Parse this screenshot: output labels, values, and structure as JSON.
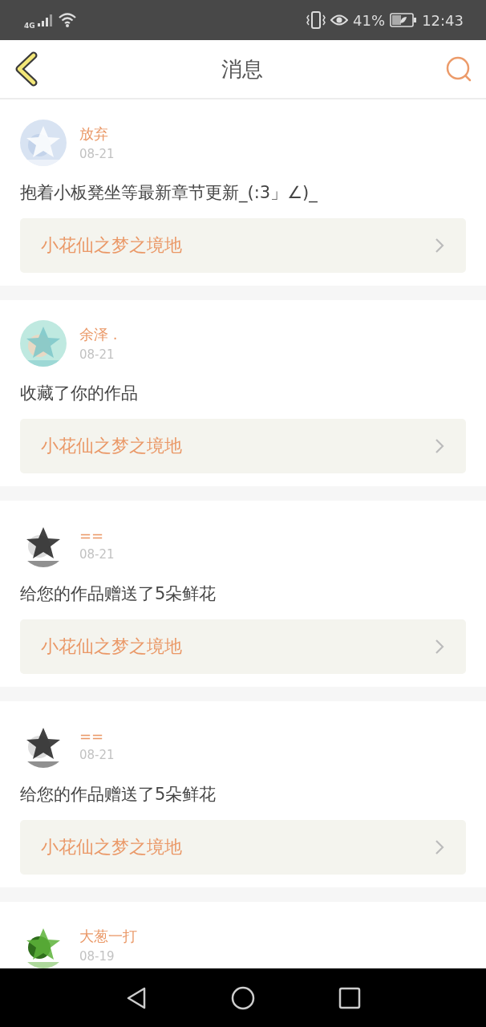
{
  "status_bar": {
    "network": "4G",
    "battery": "41%",
    "time": "12:43"
  },
  "header": {
    "title": "消息"
  },
  "messages": [
    {
      "name": "放弃",
      "date": "08-21",
      "text": "抱着小板凳坐等最新章节更新_(:3」∠)_",
      "link": "小花仙之梦之境地"
    },
    {
      "name": "余泽 .",
      "date": "08-21",
      "text": "收藏了你的作品",
      "link": "小花仙之梦之境地"
    },
    {
      "name": "==",
      "date": "08-21",
      "text": "给您的作品赠送了5朵鲜花",
      "link": "小花仙之梦之境地"
    },
    {
      "name": "==",
      "date": "08-21",
      "text": "给您的作品赠送了5朵鲜花",
      "link": "小花仙之梦之境地"
    },
    {
      "name": "大葱一打",
      "date": "08-19"
    }
  ]
}
